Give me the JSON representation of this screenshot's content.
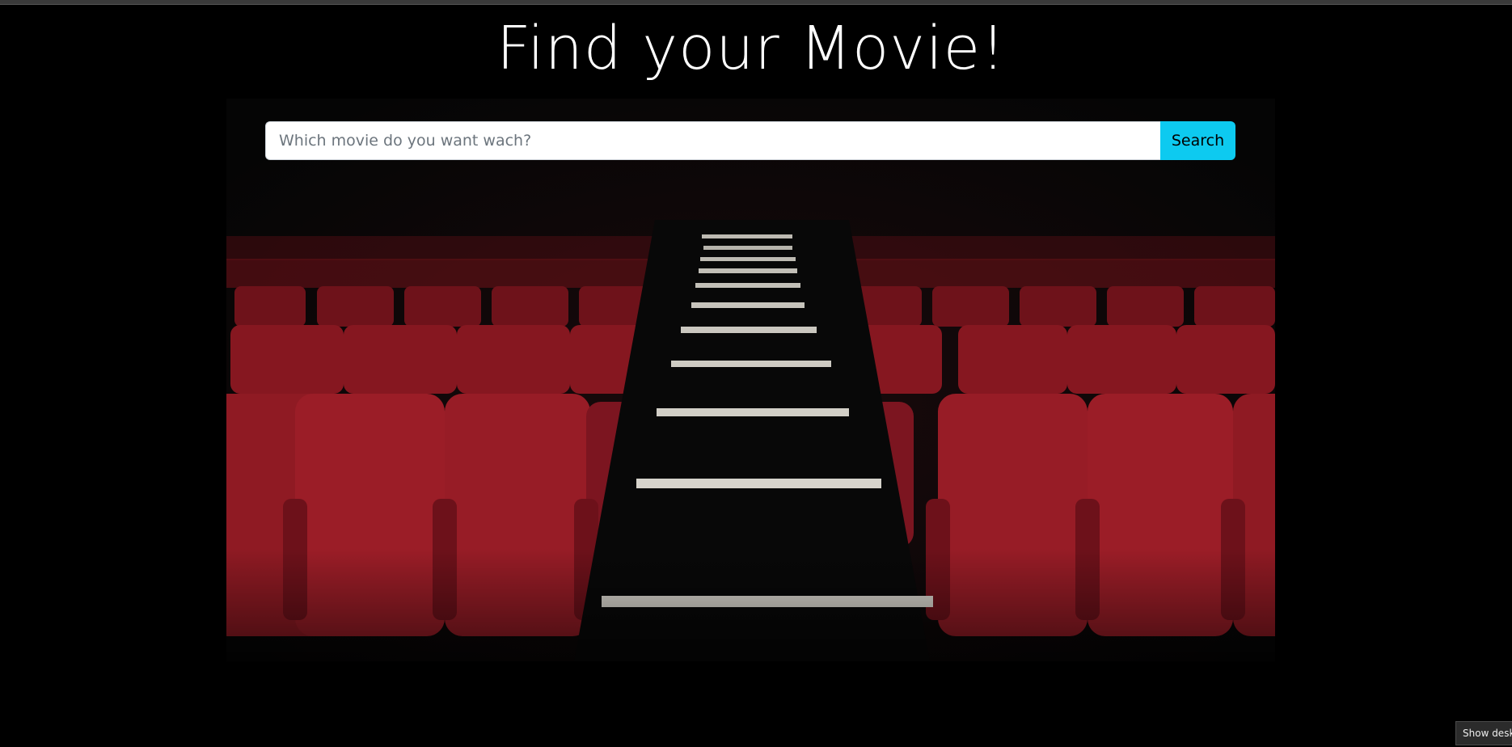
{
  "page": {
    "title": "Find your Movie!"
  },
  "search": {
    "placeholder": "Which movie do you want wach?",
    "value": "",
    "button_label": "Search"
  },
  "hero_image": {
    "subject": "cinema-seats-icon"
  },
  "taskbar": {
    "tooltip": "Show deskt"
  },
  "colors": {
    "background": "#000000",
    "accent": "#0dcaf0",
    "seat_red": "#8b1a22"
  }
}
